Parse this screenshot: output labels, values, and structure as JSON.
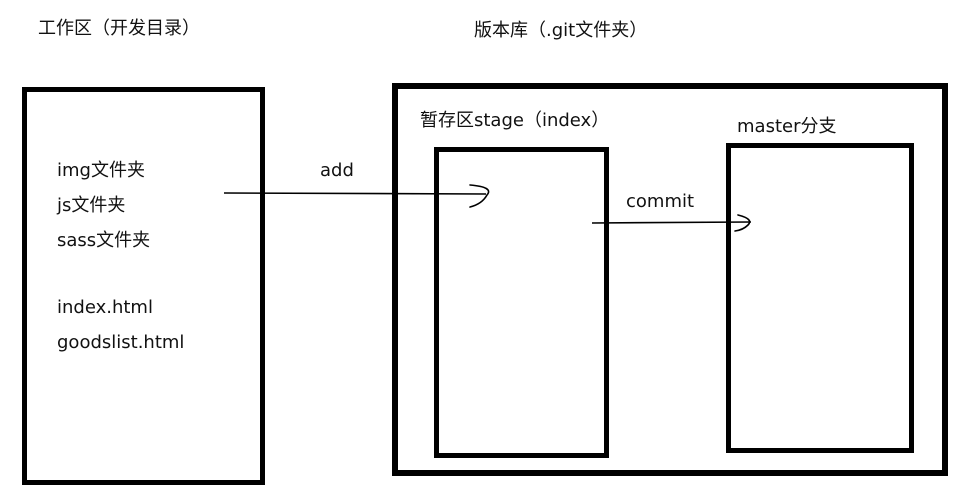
{
  "workspace": {
    "title": "工作区（开发目录）",
    "files": [
      {
        "label": "img文件夹"
      },
      {
        "label": "js文件夹"
      },
      {
        "label": "sass文件夹"
      },
      {
        "label": "index.html"
      },
      {
        "label": "goodslist.html"
      }
    ]
  },
  "repository": {
    "title": "版本库（.git文件夹）",
    "stage": {
      "title": "暂存区stage（index）"
    },
    "master": {
      "title": "master分支"
    }
  },
  "arrows": {
    "add_label": "add",
    "commit_label": "commit"
  },
  "colors": {
    "stroke": "#000000",
    "text": "#111111",
    "background": "#ffffff"
  }
}
